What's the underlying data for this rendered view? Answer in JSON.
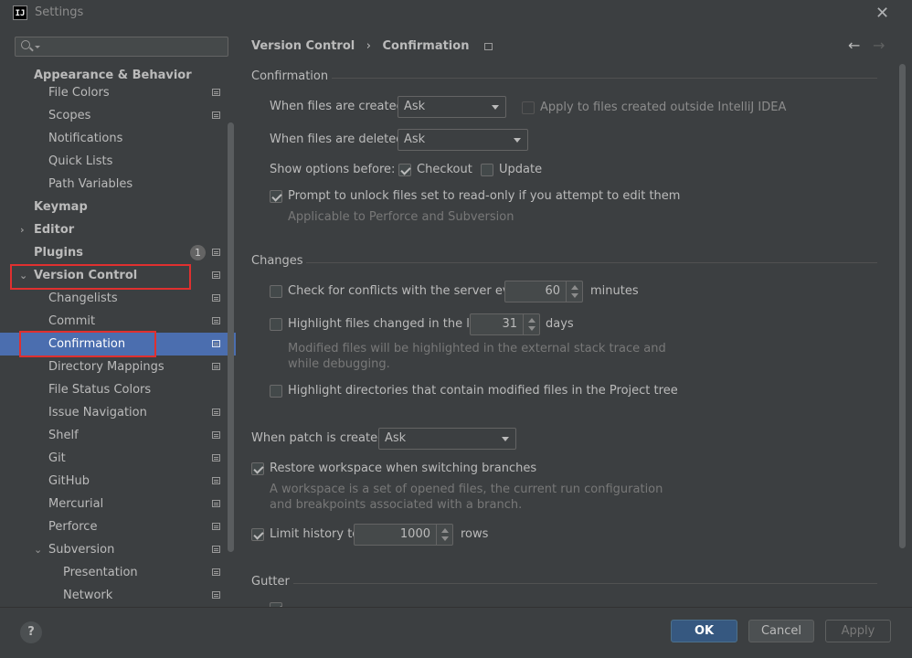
{
  "window": {
    "title": "Settings",
    "logo_text": "IJ"
  },
  "sidebar": {
    "search_placeholder": "",
    "items": [
      {
        "label": "Appearance & Behavior"
      },
      {
        "label": "File Colors"
      },
      {
        "label": "Scopes"
      },
      {
        "label": "Notifications"
      },
      {
        "label": "Quick Lists"
      },
      {
        "label": "Path Variables"
      },
      {
        "label": "Keymap"
      },
      {
        "label": "Editor"
      },
      {
        "label": "Plugins",
        "badge": "1"
      },
      {
        "label": "Version Control"
      },
      {
        "label": "Changelists"
      },
      {
        "label": "Commit"
      },
      {
        "label": "Confirmation"
      },
      {
        "label": "Directory Mappings"
      },
      {
        "label": "File Status Colors"
      },
      {
        "label": "Issue Navigation"
      },
      {
        "label": "Shelf"
      },
      {
        "label": "Git"
      },
      {
        "label": "GitHub"
      },
      {
        "label": "Mercurial"
      },
      {
        "label": "Perforce"
      },
      {
        "label": "Subversion"
      },
      {
        "label": "Presentation"
      },
      {
        "label": "Network"
      }
    ]
  },
  "breadcrumb": {
    "parent": "Version Control",
    "separator": "›",
    "current": "Confirmation"
  },
  "confirmation": {
    "title": "Confirmation",
    "files_created_label": "When files are created:",
    "files_created_value": "Ask",
    "apply_outside_label": "Apply to files created outside IntelliJ IDEA",
    "files_deleted_label": "When files are deleted:",
    "files_deleted_value": "Ask",
    "show_options_label": "Show options before:",
    "checkout_label": "Checkout",
    "update_label": "Update",
    "prompt_unlock_label": "Prompt to unlock files set to read-only if you attempt to edit them",
    "prompt_unlock_hint": "Applicable to Perforce and Subversion"
  },
  "changes": {
    "title": "Changes",
    "check_conflicts_label": "Check for conflicts with the server every",
    "check_conflicts_value": "60",
    "check_conflicts_unit": "minutes",
    "highlight_changed_label": "Highlight files changed in the last",
    "highlight_changed_value": "31",
    "highlight_changed_unit": "days",
    "highlight_hint_1": "Modified files will be highlighted in the external stack trace and",
    "highlight_hint_2": "while debugging.",
    "highlight_dirs_label": "Highlight directories that contain modified files in the Project tree"
  },
  "patch": {
    "label": "When patch is created:",
    "value": "Ask",
    "restore_label": "Restore workspace when switching branches",
    "restore_hint_1": "A workspace is a set of opened files, the current run configuration",
    "restore_hint_2": "and breakpoints associated with a branch.",
    "limit_label": "Limit history to",
    "limit_value": "1000",
    "limit_unit": "rows"
  },
  "gutter": {
    "title": "Gutter"
  },
  "buttons": {
    "help": "?",
    "ok": "OK",
    "cancel": "Cancel",
    "apply": "Apply"
  },
  "icons": {
    "back": "arrow-left-icon",
    "forward": "arrow-right-icon",
    "close": "close-icon",
    "search": "search-icon",
    "project": "project-settings-icon"
  },
  "colors": {
    "selection": "#4b6eaf",
    "highlight_box": "#e0302f",
    "ok_button": "#365880"
  }
}
